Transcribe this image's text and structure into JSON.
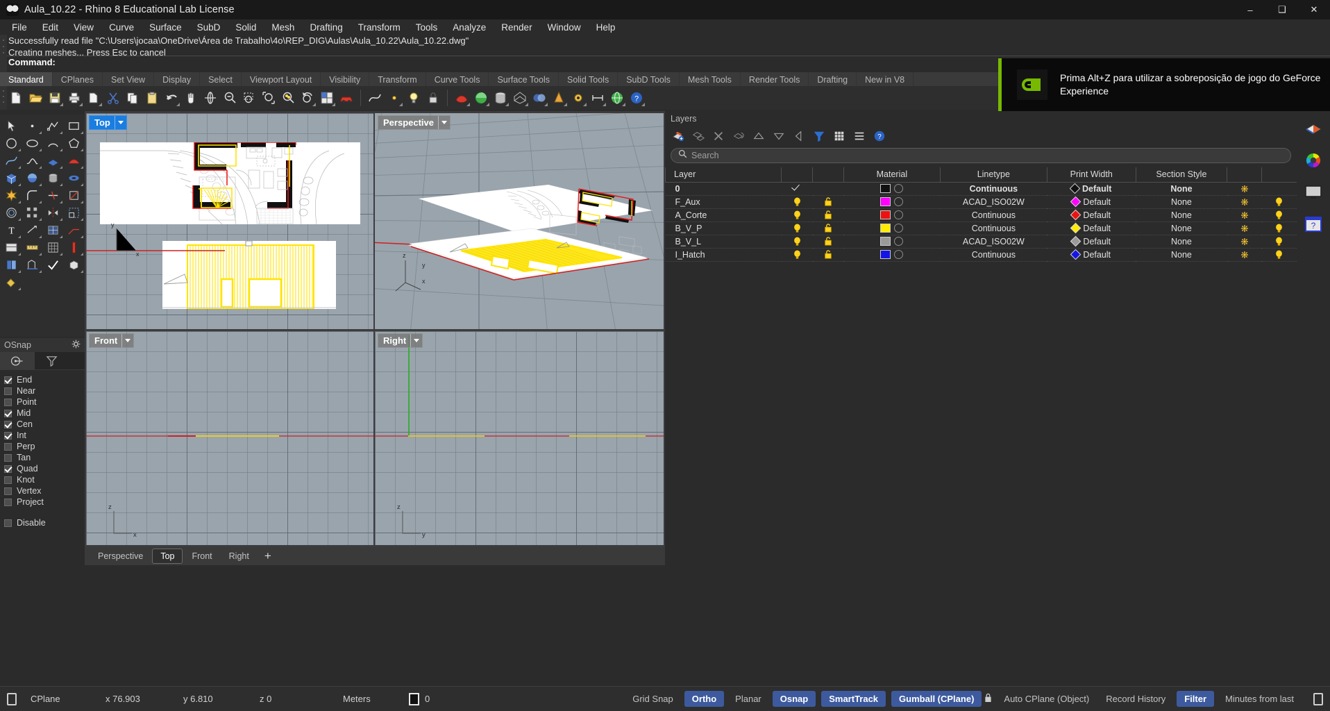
{
  "window": {
    "title": "Aula_10.22 - Rhino 8 Educational Lab License",
    "app_icon": "rhino-icon",
    "minimize": "–",
    "maximize": "❑",
    "close": "✕"
  },
  "menubar": {
    "items": [
      {
        "label": "File"
      },
      {
        "label": "Edit"
      },
      {
        "label": "View"
      },
      {
        "label": "Curve"
      },
      {
        "label": "Surface"
      },
      {
        "label": "SubD"
      },
      {
        "label": "Solid"
      },
      {
        "label": "Mesh"
      },
      {
        "label": "Drafting"
      },
      {
        "label": "Transform"
      },
      {
        "label": "Tools"
      },
      {
        "label": "Analyze"
      },
      {
        "label": "Render"
      },
      {
        "label": "Window"
      },
      {
        "label": "Help"
      }
    ]
  },
  "command_area": {
    "history_line_1": "Successfully read file \"C:\\Users\\jocaa\\OneDrive\\Área de Trabalho\\4o\\REP_DIG\\Aulas\\Aula_10.22\\Aula_10.22.dwg\"",
    "history_line_2": "Creating meshes... Press Esc to cancel",
    "prompt_label": "Command:",
    "prompt_value": ""
  },
  "toolbar_tabs": {
    "active": "Standard",
    "items": [
      {
        "label": "Standard"
      },
      {
        "label": "CPlanes"
      },
      {
        "label": "Set View"
      },
      {
        "label": "Display"
      },
      {
        "label": "Select"
      },
      {
        "label": "Viewport Layout"
      },
      {
        "label": "Visibility"
      },
      {
        "label": "Transform"
      },
      {
        "label": "Curve Tools"
      },
      {
        "label": "Surface Tools"
      },
      {
        "label": "Solid Tools"
      },
      {
        "label": "SubD Tools"
      },
      {
        "label": "Mesh Tools"
      },
      {
        "label": "Render Tools"
      },
      {
        "label": "Drafting"
      },
      {
        "label": "New in V8"
      }
    ]
  },
  "osnap": {
    "title": "OSnap",
    "gear_icon": "gear-icon",
    "tab_icons": [
      "osnap-point-icon",
      "osnap-filter-icon"
    ],
    "items": [
      {
        "label": "End",
        "checked": true
      },
      {
        "label": "Near",
        "checked": false
      },
      {
        "label": "Point",
        "checked": false
      },
      {
        "label": "Mid",
        "checked": true
      },
      {
        "label": "Cen",
        "checked": true
      },
      {
        "label": "Int",
        "checked": true
      },
      {
        "label": "Perp",
        "checked": false
      },
      {
        "label": "Tan",
        "checked": false
      },
      {
        "label": "Quad",
        "checked": true
      },
      {
        "label": "Knot",
        "checked": false
      },
      {
        "label": "Vertex",
        "checked": false
      },
      {
        "label": "Project",
        "checked": false
      }
    ],
    "disable": {
      "label": "Disable",
      "checked": false
    }
  },
  "viewports": [
    {
      "name": "Top",
      "active": true
    },
    {
      "name": "Perspective",
      "active": false
    },
    {
      "name": "Front",
      "active": false
    },
    {
      "name": "Right",
      "active": false
    }
  ],
  "viewport_tabs": {
    "items": [
      {
        "label": "Perspective",
        "active": false
      },
      {
        "label": "Top",
        "active": true
      },
      {
        "label": "Front",
        "active": false
      },
      {
        "label": "Right",
        "active": false
      }
    ],
    "add_label": "+"
  },
  "layers_panel": {
    "title": "Layers",
    "toolbar_icons": [
      "new-layer-icon",
      "new-sublayer-icon",
      "delete-layer-icon",
      "duplicate-layer-icon",
      "move-up-icon",
      "move-down-icon",
      "previous-icon",
      "filter-icon",
      "grid-view-icon",
      "list-menu-icon",
      "help-icon"
    ],
    "search": {
      "placeholder": "Search",
      "value": "",
      "icon": "search-icon"
    },
    "columns": [
      "Layer",
      "",
      "",
      "Material",
      "Linetype",
      "Print Width",
      "Section Style"
    ],
    "rows": [
      {
        "name": "0",
        "current": true,
        "on": null,
        "locked": null,
        "color": "#111111",
        "material": "",
        "linetype": "Continuous",
        "print_width": "Default",
        "print_color": "#111111",
        "section_style": "None"
      },
      {
        "name": "F_Aux",
        "current": false,
        "on": true,
        "locked": false,
        "color": "#ff00ff",
        "material": "",
        "linetype": "ACAD_ISO02W",
        "print_width": "Default",
        "print_color": "#ff00ff",
        "section_style": "None"
      },
      {
        "name": "A_Corte",
        "current": false,
        "on": true,
        "locked": false,
        "color": "#ee1111",
        "material": "",
        "linetype": "Continuous",
        "print_width": "Default",
        "print_color": "#ee1111",
        "section_style": "None"
      },
      {
        "name": "B_V_P",
        "current": false,
        "on": true,
        "locked": false,
        "color": "#ffec00",
        "material": "",
        "linetype": "Continuous",
        "print_width": "Default",
        "print_color": "#ffec00",
        "section_style": "None"
      },
      {
        "name": "B_V_L",
        "current": false,
        "on": true,
        "locked": false,
        "color": "#9a9a9a",
        "material": "",
        "linetype": "ACAD_ISO02W",
        "print_width": "Default",
        "print_color": "#9a9a9a",
        "section_style": "None"
      },
      {
        "name": "I_Hatch",
        "current": false,
        "on": true,
        "locked": false,
        "color": "#1414e6",
        "material": "",
        "linetype": "Continuous",
        "print_width": "Default",
        "print_color": "#1414e6",
        "section_style": "None"
      }
    ]
  },
  "right_strip": {
    "icons": [
      "properties-icon",
      "color-wheel-icon",
      "display-icon",
      "help-panel-icon"
    ]
  },
  "statusbar": {
    "cplane_label": "CPlane",
    "x": "x 76.903",
    "y": "y 6.810",
    "z": "z 0",
    "units": "Meters",
    "layer_color": "#111111",
    "layer_value": "0",
    "toggles": [
      {
        "label": "Grid Snap",
        "on": false
      },
      {
        "label": "Ortho",
        "on": true
      },
      {
        "label": "Planar",
        "on": false
      },
      {
        "label": "Osnap",
        "on": true
      },
      {
        "label": "SmartTrack",
        "on": true
      },
      {
        "label": "Gumball (CPlane)",
        "on": true
      },
      {
        "label": "Auto CPlane (Object)",
        "on": false,
        "icon": "lock-icon"
      },
      {
        "label": "Record History",
        "on": false
      },
      {
        "label": "Filter",
        "on": true
      },
      {
        "label": "Minutes from last",
        "on": false
      }
    ]
  },
  "nvidia_toast": {
    "icon": "nvidia-logo-icon",
    "message": "Prima Alt+Z para utilizar a sobreposição de jogo do GeForce Experience",
    "accent": "#76b900"
  }
}
